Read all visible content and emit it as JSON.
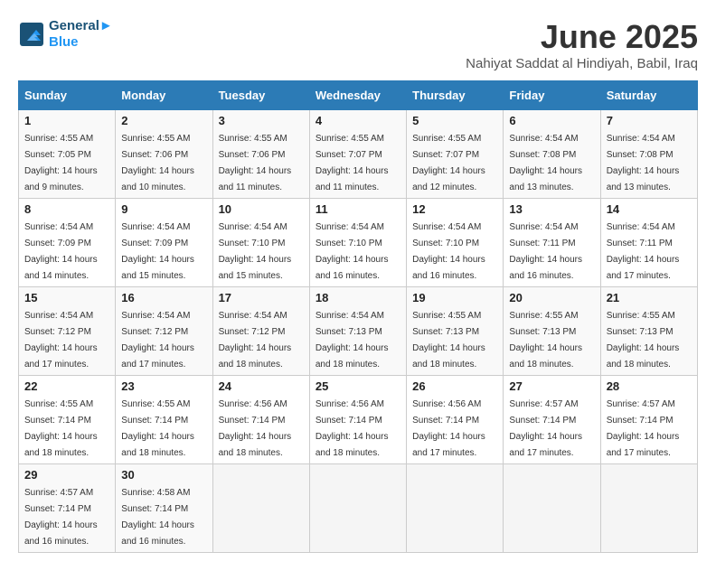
{
  "header": {
    "logo_line1": "General",
    "logo_line2": "Blue",
    "month_title": "June 2025",
    "location": "Nahiyat Saddat al Hindiyah, Babil, Iraq"
  },
  "weekdays": [
    "Sunday",
    "Monday",
    "Tuesday",
    "Wednesday",
    "Thursday",
    "Friday",
    "Saturday"
  ],
  "weeks": [
    [
      {
        "day": "1",
        "sunrise": "4:55 AM",
        "sunset": "7:05 PM",
        "daylight": "14 hours and 9 minutes."
      },
      {
        "day": "2",
        "sunrise": "4:55 AM",
        "sunset": "7:06 PM",
        "daylight": "14 hours and 10 minutes."
      },
      {
        "day": "3",
        "sunrise": "4:55 AM",
        "sunset": "7:06 PM",
        "daylight": "14 hours and 11 minutes."
      },
      {
        "day": "4",
        "sunrise": "4:55 AM",
        "sunset": "7:07 PM",
        "daylight": "14 hours and 11 minutes."
      },
      {
        "day": "5",
        "sunrise": "4:55 AM",
        "sunset": "7:07 PM",
        "daylight": "14 hours and 12 minutes."
      },
      {
        "day": "6",
        "sunrise": "4:54 AM",
        "sunset": "7:08 PM",
        "daylight": "14 hours and 13 minutes."
      },
      {
        "day": "7",
        "sunrise": "4:54 AM",
        "sunset": "7:08 PM",
        "daylight": "14 hours and 13 minutes."
      }
    ],
    [
      {
        "day": "8",
        "sunrise": "4:54 AM",
        "sunset": "7:09 PM",
        "daylight": "14 hours and 14 minutes."
      },
      {
        "day": "9",
        "sunrise": "4:54 AM",
        "sunset": "7:09 PM",
        "daylight": "14 hours and 15 minutes."
      },
      {
        "day": "10",
        "sunrise": "4:54 AM",
        "sunset": "7:10 PM",
        "daylight": "14 hours and 15 minutes."
      },
      {
        "day": "11",
        "sunrise": "4:54 AM",
        "sunset": "7:10 PM",
        "daylight": "14 hours and 16 minutes."
      },
      {
        "day": "12",
        "sunrise": "4:54 AM",
        "sunset": "7:10 PM",
        "daylight": "14 hours and 16 minutes."
      },
      {
        "day": "13",
        "sunrise": "4:54 AM",
        "sunset": "7:11 PM",
        "daylight": "14 hours and 16 minutes."
      },
      {
        "day": "14",
        "sunrise": "4:54 AM",
        "sunset": "7:11 PM",
        "daylight": "14 hours and 17 minutes."
      }
    ],
    [
      {
        "day": "15",
        "sunrise": "4:54 AM",
        "sunset": "7:12 PM",
        "daylight": "14 hours and 17 minutes."
      },
      {
        "day": "16",
        "sunrise": "4:54 AM",
        "sunset": "7:12 PM",
        "daylight": "14 hours and 17 minutes."
      },
      {
        "day": "17",
        "sunrise": "4:54 AM",
        "sunset": "7:12 PM",
        "daylight": "14 hours and 18 minutes."
      },
      {
        "day": "18",
        "sunrise": "4:54 AM",
        "sunset": "7:13 PM",
        "daylight": "14 hours and 18 minutes."
      },
      {
        "day": "19",
        "sunrise": "4:55 AM",
        "sunset": "7:13 PM",
        "daylight": "14 hours and 18 minutes."
      },
      {
        "day": "20",
        "sunrise": "4:55 AM",
        "sunset": "7:13 PM",
        "daylight": "14 hours and 18 minutes."
      },
      {
        "day": "21",
        "sunrise": "4:55 AM",
        "sunset": "7:13 PM",
        "daylight": "14 hours and 18 minutes."
      }
    ],
    [
      {
        "day": "22",
        "sunrise": "4:55 AM",
        "sunset": "7:14 PM",
        "daylight": "14 hours and 18 minutes."
      },
      {
        "day": "23",
        "sunrise": "4:55 AM",
        "sunset": "7:14 PM",
        "daylight": "14 hours and 18 minutes."
      },
      {
        "day": "24",
        "sunrise": "4:56 AM",
        "sunset": "7:14 PM",
        "daylight": "14 hours and 18 minutes."
      },
      {
        "day": "25",
        "sunrise": "4:56 AM",
        "sunset": "7:14 PM",
        "daylight": "14 hours and 18 minutes."
      },
      {
        "day": "26",
        "sunrise": "4:56 AM",
        "sunset": "7:14 PM",
        "daylight": "14 hours and 17 minutes."
      },
      {
        "day": "27",
        "sunrise": "4:57 AM",
        "sunset": "7:14 PM",
        "daylight": "14 hours and 17 minutes."
      },
      {
        "day": "28",
        "sunrise": "4:57 AM",
        "sunset": "7:14 PM",
        "daylight": "14 hours and 17 minutes."
      }
    ],
    [
      {
        "day": "29",
        "sunrise": "4:57 AM",
        "sunset": "7:14 PM",
        "daylight": "14 hours and 16 minutes."
      },
      {
        "day": "30",
        "sunrise": "4:58 AM",
        "sunset": "7:14 PM",
        "daylight": "14 hours and 16 minutes."
      },
      null,
      null,
      null,
      null,
      null
    ]
  ]
}
